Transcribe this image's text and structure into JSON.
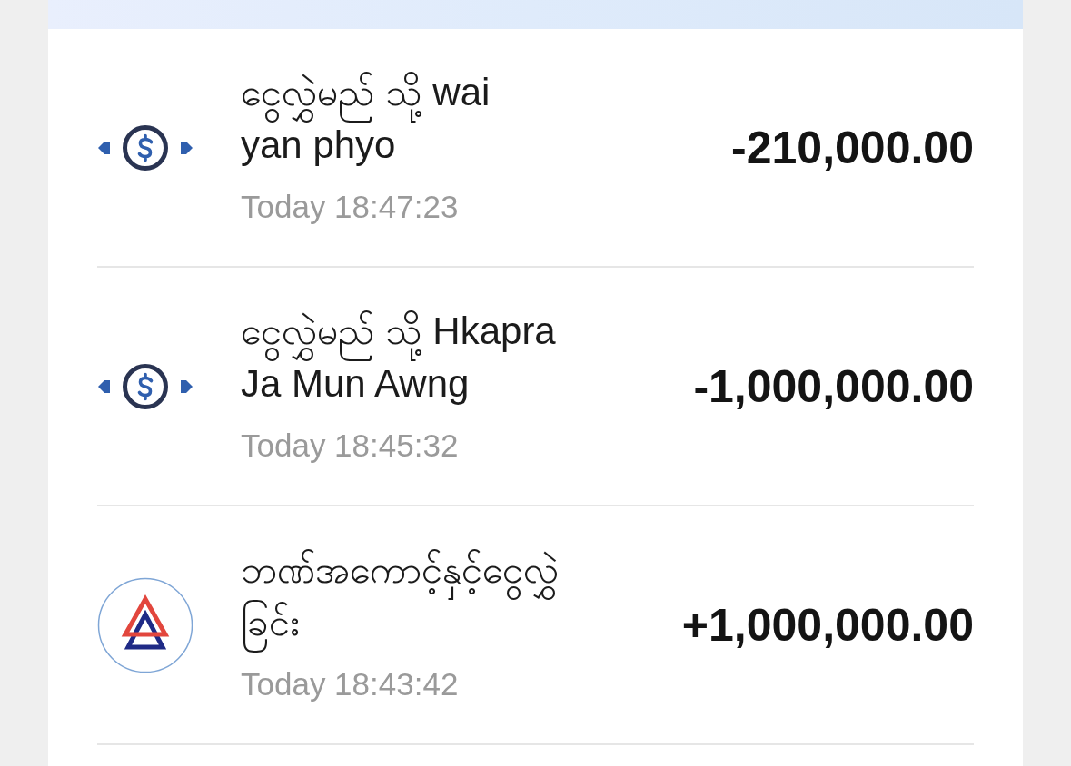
{
  "transactions": [
    {
      "kind": "transfer",
      "title": "ငွေလွှဲမည် သို့ wai yan phyo",
      "time": "Today 18:47:23",
      "amount": "-210,000.00"
    },
    {
      "kind": "transfer",
      "title": "ငွေလွှဲမည် သို့ Hkapra Ja Mun Awng",
      "time": "Today 18:45:32",
      "amount": "-1,000,000.00"
    },
    {
      "kind": "bank",
      "title": "ဘဏ်အကောင့်နှင့်ငွေလွှဲခြင်း",
      "time": "Today 18:43:42",
      "amount": "+1,000,000.00"
    }
  ]
}
